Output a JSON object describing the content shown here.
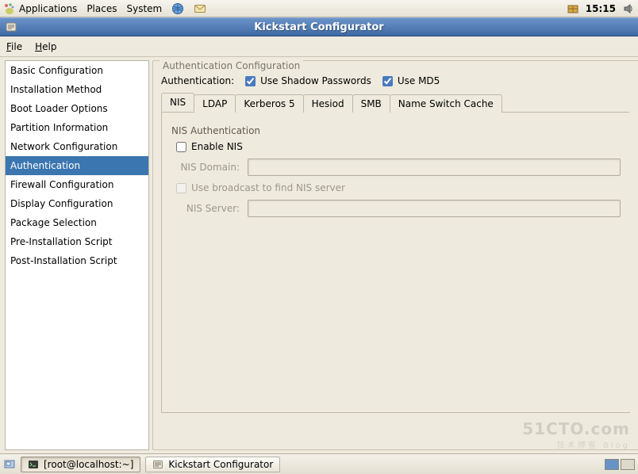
{
  "panel": {
    "apps": "Applications",
    "places": "Places",
    "system": "System",
    "clock": "15:15"
  },
  "window": {
    "title": "Kickstart Configurator"
  },
  "menubar": {
    "file": "File",
    "help": "Help"
  },
  "sidebar": {
    "items": [
      "Basic Configuration",
      "Installation Method",
      "Boot Loader Options",
      "Partition Information",
      "Network Configuration",
      "Authentication",
      "Firewall Configuration",
      "Display Configuration",
      "Package Selection",
      "Pre-Installation Script",
      "Post-Installation Script"
    ],
    "selected_index": 5
  },
  "right": {
    "legend": "Authentication Configuration",
    "row_label": "Authentication:",
    "shadow_label": "Use Shadow Passwords",
    "shadow_checked": true,
    "md5_label": "Use MD5",
    "md5_checked": true
  },
  "tabs": {
    "items": [
      "NIS",
      "LDAP",
      "Kerberos 5",
      "Hesiod",
      "SMB",
      "Name Switch Cache"
    ],
    "active_index": 0
  },
  "nis": {
    "fieldset_legend": "NIS Authentication",
    "enable_label": "Enable NIS",
    "enable_checked": false,
    "domain_label": "NIS Domain:",
    "domain_value": "",
    "broadcast_label": "Use broadcast to find NIS server",
    "broadcast_checked": false,
    "server_label": "NIS Server:",
    "server_value": ""
  },
  "taskbar": {
    "term_label": "[root@localhost:~]",
    "app_label": "Kickstart Configurator"
  },
  "watermark": {
    "main": "51CTO.com",
    "sub": "技术博客   Blog"
  }
}
